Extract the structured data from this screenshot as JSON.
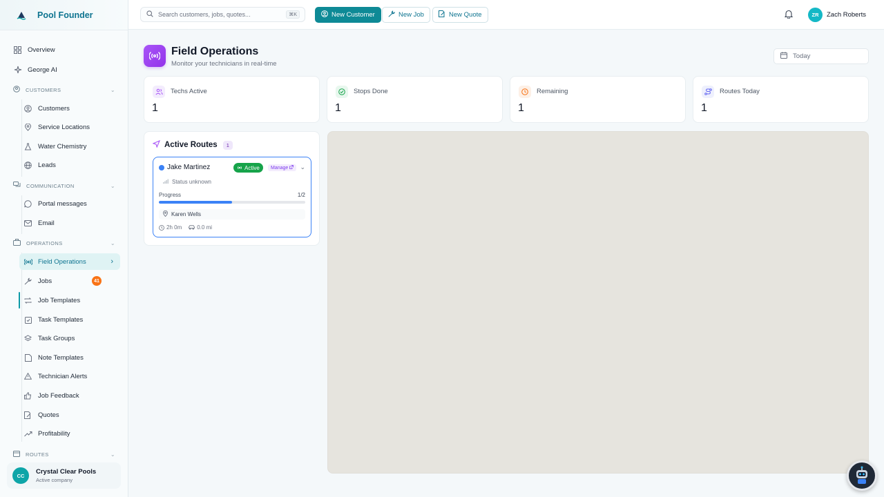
{
  "brand": {
    "name": "Pool Founder"
  },
  "sidebar": {
    "top_items": [
      {
        "label": "Overview",
        "icon": "grid-icon"
      },
      {
        "label": "George AI",
        "icon": "sparkles-icon"
      }
    ],
    "sections": {
      "customers": {
        "label": "CUSTOMERS",
        "items": [
          "Customers",
          "Service Locations",
          "Water Chemistry",
          "Leads"
        ]
      },
      "communication": {
        "label": "COMMUNICATION",
        "items": [
          "Portal messages",
          "Email"
        ]
      },
      "operations": {
        "label": "OPERATIONS",
        "items": [
          "Field Operations",
          "Jobs",
          "Job Templates",
          "Task Templates",
          "Task Groups",
          "Note Templates",
          "Technician Alerts",
          "Job Feedback",
          "Quotes",
          "Profitability"
        ]
      },
      "routes": {
        "label": "ROUTES"
      }
    },
    "jobs_badge": "41",
    "company": {
      "initials": "CC",
      "name": "Crystal Clear Pools",
      "subtitle": "Active company"
    }
  },
  "topbar": {
    "search_placeholder": "Search customers, jobs, quotes...",
    "search_shortcut": "⌘K",
    "new_customer": "New Customer",
    "new_job": "New Job",
    "new_quote": "New Quote",
    "user": {
      "initials": "ZR",
      "name": "Zach Roberts"
    }
  },
  "page": {
    "title": "Field Operations",
    "subtitle": "Monitor your technicians in real-time",
    "date_filter": "Today"
  },
  "stats": [
    {
      "label": "Techs Active",
      "value": "1",
      "color": "#a855f7"
    },
    {
      "label": "Stops Done",
      "value": "1",
      "color": "#16a34a"
    },
    {
      "label": "Remaining",
      "value": "1",
      "color": "#f97316"
    },
    {
      "label": "Routes Today",
      "value": "1",
      "color": "#6366f1"
    }
  ],
  "routes": {
    "title": "Active Routes",
    "count": "1",
    "card": {
      "tech_name": "Jake Martinez",
      "status": "Active",
      "manage": "Manage",
      "status_text": "Status unknown",
      "progress_label": "Progress",
      "progress_count": "1/2",
      "progress_fraction": 0.5,
      "stop_name": "Karen Wells",
      "duration": "2h 0m",
      "distance": "0.0 mi"
    }
  },
  "colors": {
    "accent": "#0e8a96",
    "brand": "#0e7490",
    "route": "#3b82f6",
    "active": "#16a34a"
  }
}
